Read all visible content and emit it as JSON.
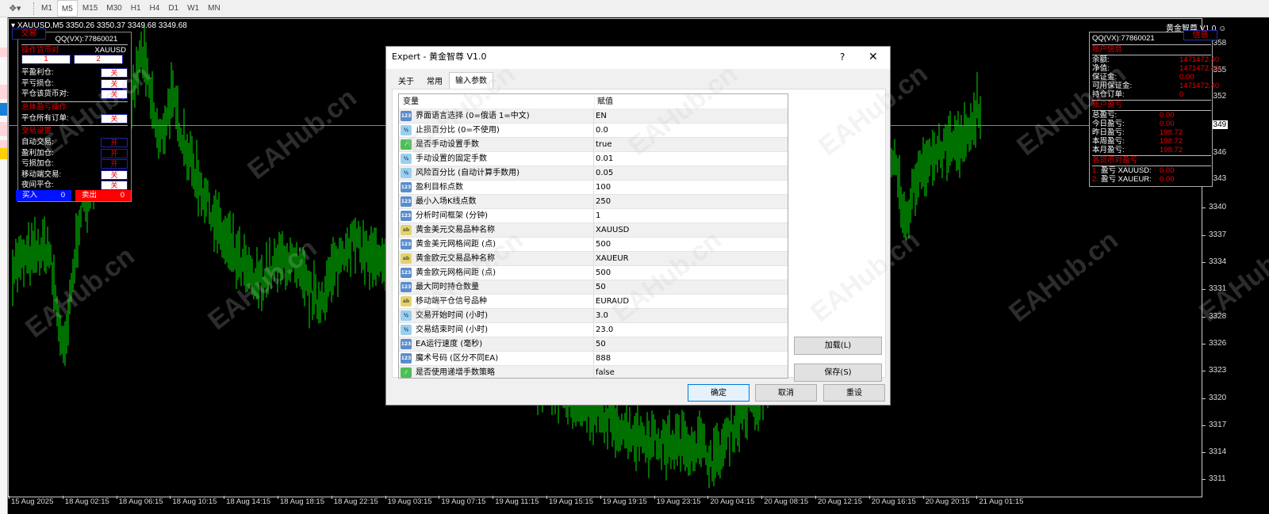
{
  "toolbar": {
    "tool_icon": "crosshair-tools-icon",
    "timeframes": [
      "M1",
      "M5",
      "M15",
      "M30",
      "H1",
      "H4",
      "D1",
      "W1",
      "MN"
    ],
    "active_timeframe": "M5"
  },
  "chart": {
    "symbol_line": "XAUUSD,M5  3350.26 3350.37 3349.68 3349.68",
    "ea_name": "黄金智尊 V1.0 ☺",
    "bar_color": "#00e000",
    "current_price": "3349",
    "y_labels": [
      "3358",
      "3355",
      "3352",
      "3349",
      "3346",
      "3343",
      "3340",
      "3337",
      "3334",
      "3331",
      "3328",
      "3326",
      "3323",
      "3320",
      "3317",
      "3314",
      "3311"
    ],
    "x_labels": [
      "15 Aug 2025",
      "18 Aug 02:15",
      "18 Aug 06:15",
      "18 Aug 10:15",
      "18 Aug 14:15",
      "18 Aug 18:15",
      "18 Aug 22:15",
      "19 Aug 03:15",
      "19 Aug 07:15",
      "19 Aug 11:15",
      "19 Aug 15:15",
      "19 Aug 19:15",
      "19 Aug 23:15",
      "20 Aug 04:15",
      "20 Aug 08:15",
      "20 Aug 12:15",
      "20 Aug 16:15",
      "20 Aug 20:15",
      "21 Aug 01:15"
    ],
    "watermark": "EAHub.cn"
  },
  "left_panel": {
    "tab": "交易",
    "qq": "QQ(VX):77860021",
    "pair_section": "操作货币对",
    "pair_value": "XAUUSD",
    "pair_buttons": [
      "1",
      "2"
    ],
    "rows1": [
      {
        "label": "平盈利仓:",
        "state": "关"
      },
      {
        "label": "平亏损仓:",
        "state": "关"
      },
      {
        "label": "平仓该货币对:",
        "state": "关"
      }
    ],
    "section2": "总体盈亏操作",
    "rows2": [
      {
        "label": "平仓所有订单:",
        "state": "关"
      }
    ],
    "section3": "交易设置",
    "rows3": [
      {
        "label": "自动交易:",
        "state": "开"
      },
      {
        "label": "盈利加仓:",
        "state": "开"
      },
      {
        "label": "亏损加仓:",
        "state": "开"
      },
      {
        "label": "移动端交易:",
        "state": "关"
      },
      {
        "label": "夜间平仓:",
        "state": "关"
      }
    ],
    "buy_label": "买入",
    "buy_count": "0",
    "sell_label": "卖出",
    "sell_count": "0"
  },
  "right_panel": {
    "tab": "信息",
    "qq": "QQ(VX):77860021",
    "account_section": "账户信息",
    "account": [
      {
        "label": "余额:",
        "value": "1471472.40"
      },
      {
        "label": "净值:",
        "value": "1471472.40"
      },
      {
        "label": "保证金:",
        "value": "0.00"
      },
      {
        "label": "可用保证金:",
        "value": "1471472.40"
      },
      {
        "label": "持仓订单:",
        "value": "0"
      }
    ],
    "pnl_section": "账户盈亏",
    "pnl": [
      {
        "label": "总盈亏:",
        "value": "0.00"
      },
      {
        "label": "今日盈亏:",
        "value": "0.00"
      },
      {
        "label": "昨日盈亏:",
        "value": "198.72"
      },
      {
        "label": "本周盈亏:",
        "value": "198.72"
      },
      {
        "label": "本月盈亏:",
        "value": "198.72"
      }
    ],
    "pair_section": "各货币对盈亏",
    "pairs": [
      {
        "num": "1.",
        "label": "盈亏 XAUUSD:",
        "value": "0.00"
      },
      {
        "num": "2.",
        "label": "盈亏 XAUEUR:",
        "value": "0.00"
      }
    ]
  },
  "dialog": {
    "title": "Expert - 黄金智尊 V1.0",
    "help": "?",
    "close": "✕",
    "tabs": [
      "关于",
      "常用",
      "输入参数"
    ],
    "active_tab": "输入参数",
    "col_variable": "变量",
    "col_value": "赋值",
    "params": [
      {
        "type": "int",
        "icon_text": "123",
        "name": "界面语言选择 (0=俄语 1=中文)",
        "value": "EN"
      },
      {
        "type": "dbl",
        "icon_text": "½",
        "name": "止损百分比 (0=不使用)",
        "value": "0.0"
      },
      {
        "type": "bool",
        "icon_text": "⁄",
        "name": "是否手动设置手数",
        "value": "true"
      },
      {
        "type": "dbl",
        "icon_text": "½",
        "name": "手动设置的固定手数",
        "value": "0.01"
      },
      {
        "type": "dbl",
        "icon_text": "½",
        "name": "风险百分比 (自动计算手数用)",
        "value": "0.05"
      },
      {
        "type": "int",
        "icon_text": "123",
        "name": "盈利目标点数",
        "value": "100"
      },
      {
        "type": "int",
        "icon_text": "123",
        "name": "最小入场K线点数",
        "value": "250"
      },
      {
        "type": "int",
        "icon_text": "123",
        "name": "分析时间框架 (分钟)",
        "value": "1"
      },
      {
        "type": "str",
        "icon_text": "ab",
        "name": "黄金美元交易品种名称",
        "value": "XAUUSD"
      },
      {
        "type": "int",
        "icon_text": "123",
        "name": "黄金美元网格间距 (点)",
        "value": "500"
      },
      {
        "type": "str",
        "icon_text": "ab",
        "name": "黄金欧元交易品种名称",
        "value": "XAUEUR"
      },
      {
        "type": "int",
        "icon_text": "123",
        "name": "黄金欧元网格间距 (点)",
        "value": "500"
      },
      {
        "type": "int",
        "icon_text": "123",
        "name": "最大同时持仓数量",
        "value": "50"
      },
      {
        "type": "str",
        "icon_text": "ab",
        "name": "移动端平仓信号品种",
        "value": "EURAUD"
      },
      {
        "type": "dbl",
        "icon_text": "½",
        "name": "交易开始时间 (小时)",
        "value": "3.0"
      },
      {
        "type": "dbl",
        "icon_text": "½",
        "name": "交易结束时间 (小时)",
        "value": "23.0"
      },
      {
        "type": "int",
        "icon_text": "123",
        "name": "EA运行速度 (毫秒)",
        "value": "50"
      },
      {
        "type": "int",
        "icon_text": "123",
        "name": "魔术号码 (区分不同EA)",
        "value": "888"
      },
      {
        "type": "bool",
        "icon_text": "⁄",
        "name": "是否使用递增手数策略",
        "value": "false"
      }
    ],
    "load_label": "加载(L)",
    "save_label": "保存(S)",
    "ok_label": "确定",
    "cancel_label": "取消",
    "reset_label": "重设"
  }
}
